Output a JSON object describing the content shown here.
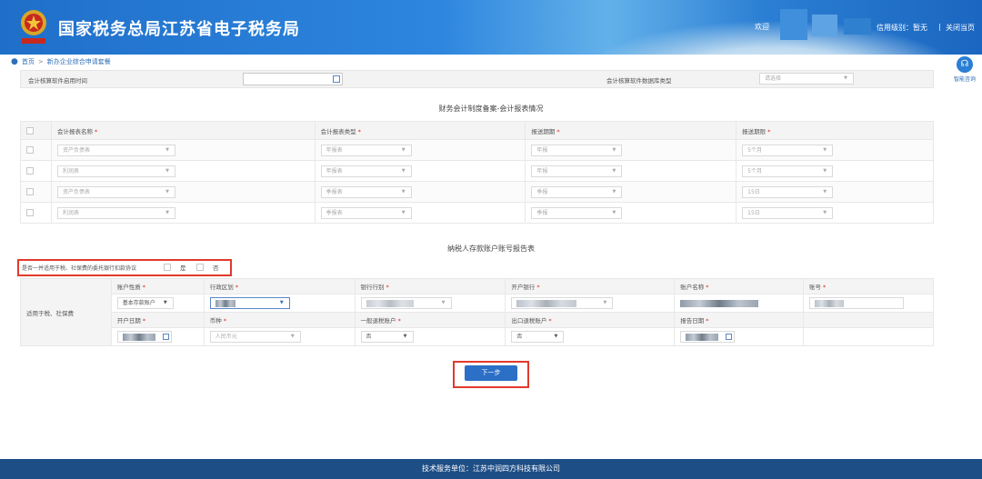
{
  "header": {
    "title": "国家税务总局江苏省电子税务局",
    "welcome": "欢迎",
    "credit_label": "信用级别：暂无",
    "close_link": "关闭当页",
    "divider": "|"
  },
  "breadcrumb": {
    "home": "首页",
    "sep": ">",
    "current": "新办企业综合申请套餐"
  },
  "assist": {
    "label": "智能咨询"
  },
  "software": {
    "start_label": "会计核算软件启用时间",
    "db_label": "会计核算软件数据库类型",
    "db_placeholder": "请选择"
  },
  "report_section": {
    "title": "财务会计制度备案-会计报表情况",
    "headers": [
      "会计报表名称",
      "会计报表类型",
      "报送期期",
      "报送期限"
    ],
    "rows": [
      [
        "资产负债表",
        "年报表",
        "年报",
        "5个月"
      ],
      [
        "利润表",
        "年报表",
        "年报",
        "5个月"
      ],
      [
        "资产负债表",
        "季报表",
        "季报",
        "15日"
      ],
      [
        "利润表",
        "季报表",
        "季报",
        "15日"
      ]
    ]
  },
  "account_section": {
    "title": "纳税人存款账户账号报告表",
    "agree_text": "是否一并适用于税、社保费的委托银行扣款协议",
    "yes": "是",
    "no": "否",
    "side_label": "适用于税、社保费",
    "headers1": [
      "账户性质",
      "行政区划",
      "银行行别",
      "开户银行",
      "账户名称",
      "账号"
    ],
    "headers2": [
      "开户日期",
      "币种",
      "一般退税账户",
      "出口退税账户",
      "报告日期"
    ],
    "account_type": "基本存款账户",
    "currency": "人民币元",
    "general_refund": "否",
    "export_refund": "否"
  },
  "actions": {
    "next": "下一步"
  },
  "footer": {
    "text": "技术服务单位：江苏中润四方科技有限公司"
  },
  "colors": {
    "primary": "#2b6fc6",
    "highlight": "#e03a2c",
    "footer": "#1e4e86"
  }
}
